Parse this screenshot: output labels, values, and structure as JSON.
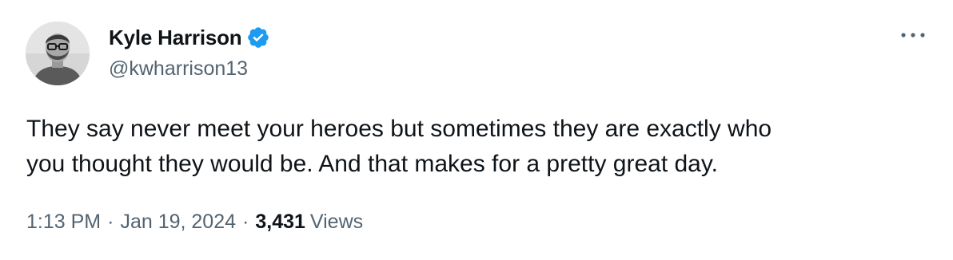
{
  "author": {
    "display_name": "Kyle Harrison",
    "handle": "@kwharrison13",
    "verified_icon": "verified-badge-icon",
    "avatar_icon": "avatar"
  },
  "tweet": {
    "text": "They say never meet your heroes but sometimes they are exactly who\nyou thought they would be. And that makes for a pretty great day.",
    "time": "1:13 PM",
    "separator": "·",
    "date": "Jan 19, 2024",
    "views_count": "3,431",
    "views_label": "Views"
  },
  "actions": {
    "more_icon": "more-options-icon"
  },
  "colors": {
    "text_primary": "#0f1419",
    "text_secondary": "#536471",
    "verified_blue": "#1d9bf0"
  }
}
